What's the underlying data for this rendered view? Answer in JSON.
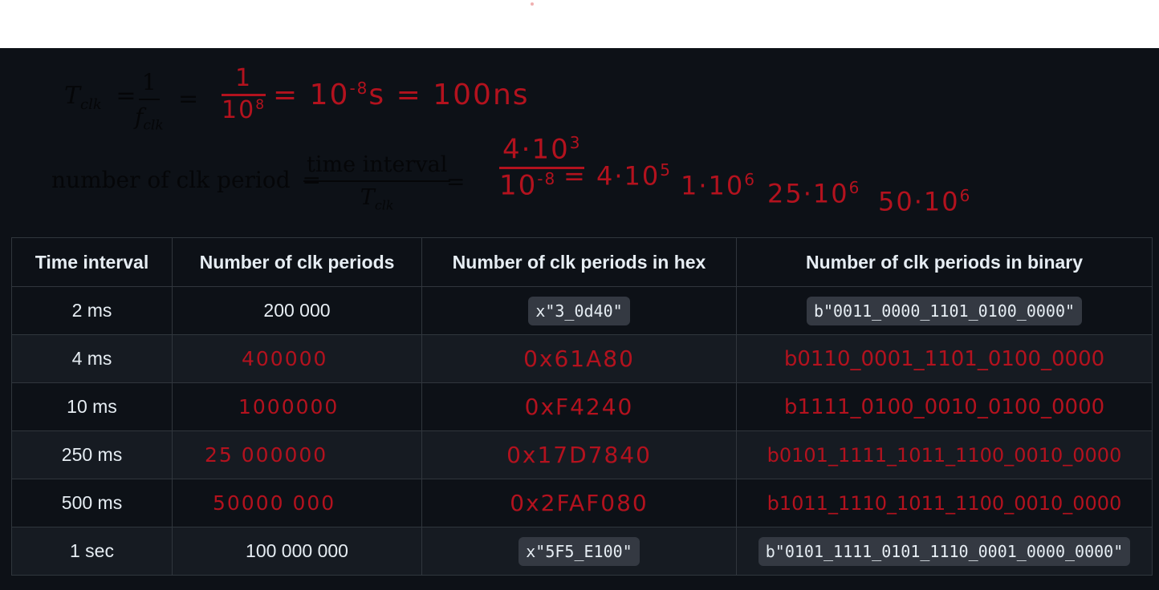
{
  "formula1": {
    "lhs": "T",
    "lhs_sub": "clk",
    "num": "1",
    "den": "f",
    "den_sub": "clk",
    "eq": "="
  },
  "formula2": {
    "lhs": "number of clk period",
    "num": "time interval",
    "den": "T",
    "den_sub": "clk",
    "eq": "="
  },
  "handwriting": {
    "line1": [
      "1",
      "10",
      "8",
      "=",
      "10",
      "-8",
      "s",
      "=",
      "100ns"
    ],
    "line2_frac_num": "4·10",
    "line2_frac_num_exp": "3",
    "line2_frac_den": "10",
    "line2_frac_den_exp": "-8",
    "line2_items": [
      {
        "text": "= 4·10",
        "exp": "5"
      },
      {
        "text": "1·10",
        "exp": "6"
      },
      {
        "text": "25·10",
        "exp": "6"
      },
      {
        "text": "50·10",
        "exp": "6"
      }
    ]
  },
  "table": {
    "headers": [
      "Time interval",
      "Number of clk periods",
      "Number of clk periods in hex",
      "Number of clk periods in binary"
    ],
    "rows": [
      {
        "interval": "2 ms",
        "periods": "200 000",
        "hex": "x\"3_0d40\"",
        "binary": "b\"0011_0000_1101_0100_0000\"",
        "handwritten": false
      },
      {
        "interval": "4 ms",
        "periods": "400000",
        "hex": "0x61A80",
        "binary": "b0110_0001_1101_0100_0000",
        "handwritten": true
      },
      {
        "interval": "10 ms",
        "periods": "1000000",
        "hex": "0xF4240",
        "binary": "b1111_0100_0010_0100_0000",
        "handwritten": true
      },
      {
        "interval": "250 ms",
        "periods": "25 000000",
        "hex": "0x17D7840",
        "binary": "b0101_1111_1011_1100_0010_0000",
        "handwritten": true
      },
      {
        "interval": "500 ms",
        "periods": "50000 000",
        "hex": "0x2FAF080",
        "binary": "b1011_1110_1011_1100_0010_0000",
        "handwritten": true
      },
      {
        "interval": "1 sec",
        "periods": "100 000 000",
        "hex": "x\"5F5_E100\"",
        "binary": "b\"0101_1111_0101_1110_0001_0000_0000\"",
        "handwritten": false
      }
    ]
  },
  "colors": {
    "background": "#0d1117",
    "ink": "#b3121e",
    "code_bg": "#343942"
  }
}
